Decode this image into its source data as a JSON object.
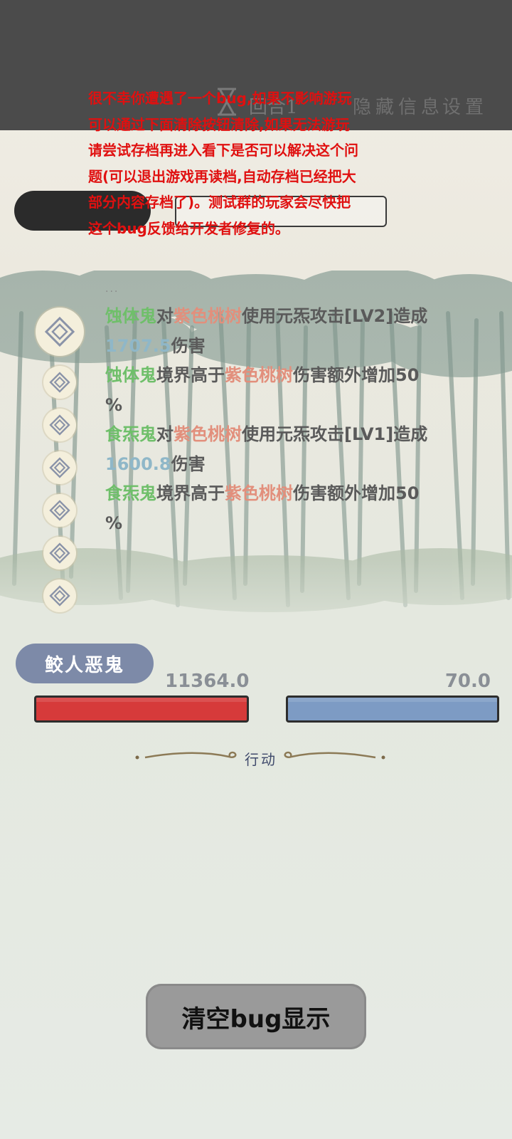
{
  "top_menu": {
    "round_label": "回合1",
    "hide_info_label": "隐藏信息",
    "settings_label": "设置"
  },
  "bug_message": "很不幸你遭遇了一个bug,如果不影响游玩\n可以通过下面清除按钮清除,如果无法游玩\n请尝试存档再进入看下是否可以解决这个问\n题(可以退出游戏再读档,自动存档已经把大\n部分内容存档了)。测试群的玩家会尽快把\n这个bug反馈给开发者修复的。",
  "battle_log": {
    "ellipsis": "···",
    "entries": [
      {
        "attacker": "蚀体鬼",
        "verb": "对",
        "target": "紫色桃树",
        "action": "使用元炁攻击[LV2]造成",
        "damage": "1707.5",
        "suffix": "伤害"
      },
      {
        "attacker": "蚀体鬼",
        "verb": "境界高于",
        "target": "紫色桃树",
        "action": "伤害额外增加50",
        "tail": "%"
      },
      {
        "attacker": "食炁鬼",
        "verb": "对",
        "target": "紫色桃树",
        "action": "使用元炁攻击[LV1]造成",
        "damage": "1600.8",
        "suffix": "伤害"
      },
      {
        "attacker": "食炁鬼",
        "verb": "境界高于",
        "target": "紫色桃树",
        "action": "伤害额外增加50",
        "tail": "%"
      }
    ]
  },
  "enemy": {
    "name": "鲛人恶鬼",
    "hp": "11364.0",
    "mp": "70.0",
    "hp_fraction": 1.0,
    "mp_fraction": 1.0
  },
  "action_section": {
    "label": "行动"
  },
  "clear_button": {
    "label": "清空bug显示"
  },
  "colors": {
    "topbar": "#4b4b4b",
    "bug_text": "#e01010",
    "attacker": "#6fbf6a",
    "target": "#e28f7c",
    "damage": "#8fb7c8",
    "hp_bar": "#d63a3a",
    "mp_bar": "#7d9bc4"
  },
  "icons": [
    "hourglass-icon",
    "skill-diamond-icon"
  ]
}
